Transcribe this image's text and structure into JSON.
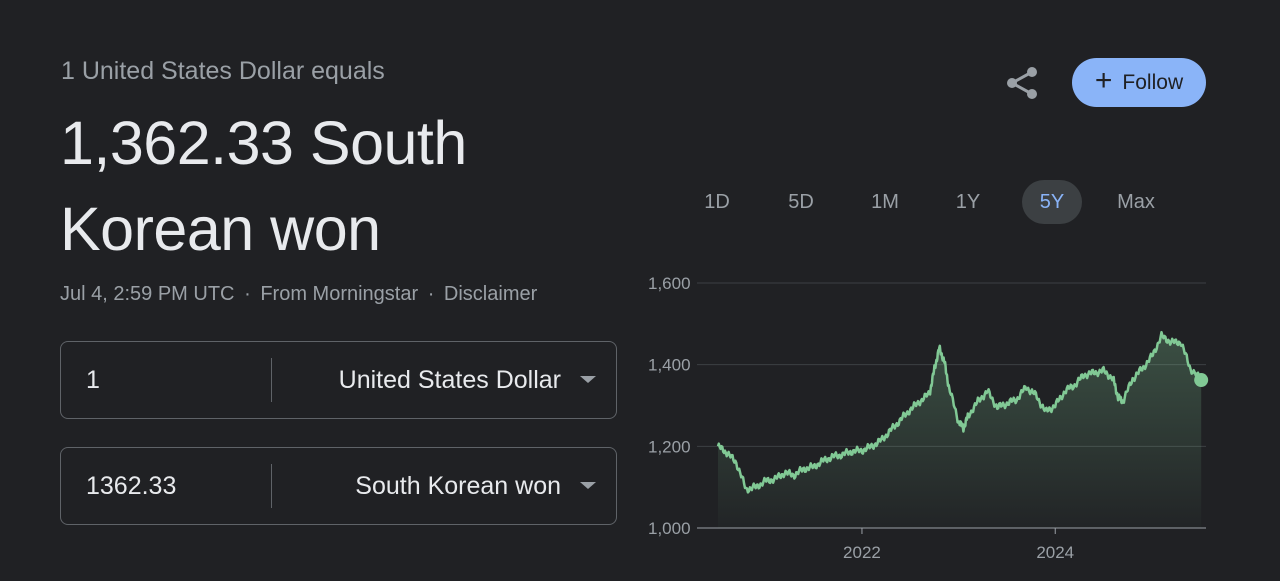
{
  "header": {
    "subtitle": "1 United States Dollar equals",
    "rate_line1": "1,362.33 South",
    "rate_line2": "Korean won",
    "timestamp": "Jul 4, 2:59 PM UTC",
    "source": "From Morningstar",
    "disclaimer": "Disclaimer",
    "separator": "·"
  },
  "actions": {
    "share_icon": "share-icon",
    "follow_label": "Follow",
    "follow_icon": "+",
    "follow_color": "#8ab4f8"
  },
  "converter": {
    "from": {
      "amount": "1",
      "currency": "United States Dollar"
    },
    "to": {
      "amount": "1362.33",
      "currency": "South Korean won"
    }
  },
  "ranges": {
    "items": [
      "1D",
      "5D",
      "1M",
      "1Y",
      "5Y",
      "Max"
    ],
    "selected": "5Y"
  },
  "chart_data": {
    "type": "area",
    "ylim": [
      1000,
      1600
    ],
    "yticks": [
      "1,600",
      "1,400",
      "1,200",
      "1,000"
    ],
    "ytick_values": [
      1600,
      1400,
      1200,
      1000
    ],
    "xticks": [
      "2022",
      "2024"
    ],
    "xtick_values": [
      2022.0,
      2024.0
    ],
    "line_color": "#81c995",
    "x": [
      2020.51,
      2020.6,
      2020.7,
      2020.8,
      2020.9,
      2021.0,
      2021.1,
      2021.2,
      2021.3,
      2021.4,
      2021.5,
      2021.6,
      2021.7,
      2021.8,
      2021.9,
      2022.0,
      2022.1,
      2022.2,
      2022.3,
      2022.4,
      2022.5,
      2022.6,
      2022.7,
      2022.75,
      2022.8,
      2022.85,
      2022.9,
      2023.0,
      2023.05,
      2023.1,
      2023.2,
      2023.3,
      2023.4,
      2023.5,
      2023.6,
      2023.7,
      2023.8,
      2023.9,
      2024.0,
      2024.1,
      2024.2,
      2024.3,
      2024.4,
      2024.5,
      2024.6,
      2024.65,
      2024.7,
      2024.8,
      2024.9,
      2025.0,
      2025.1,
      2025.2,
      2025.3,
      2025.4,
      2025.51
    ],
    "y": [
      1200,
      1185,
      1160,
      1095,
      1100,
      1115,
      1120,
      1135,
      1130,
      1145,
      1150,
      1165,
      1175,
      1180,
      1188,
      1190,
      1200,
      1215,
      1240,
      1265,
      1290,
      1310,
      1330,
      1390,
      1440,
      1410,
      1345,
      1260,
      1245,
      1275,
      1310,
      1335,
      1295,
      1305,
      1315,
      1345,
      1325,
      1285,
      1300,
      1335,
      1350,
      1375,
      1380,
      1385,
      1365,
      1320,
      1310,
      1365,
      1390,
      1420,
      1470,
      1455,
      1455,
      1390,
      1362.33
    ],
    "last_value": 1362.33
  }
}
